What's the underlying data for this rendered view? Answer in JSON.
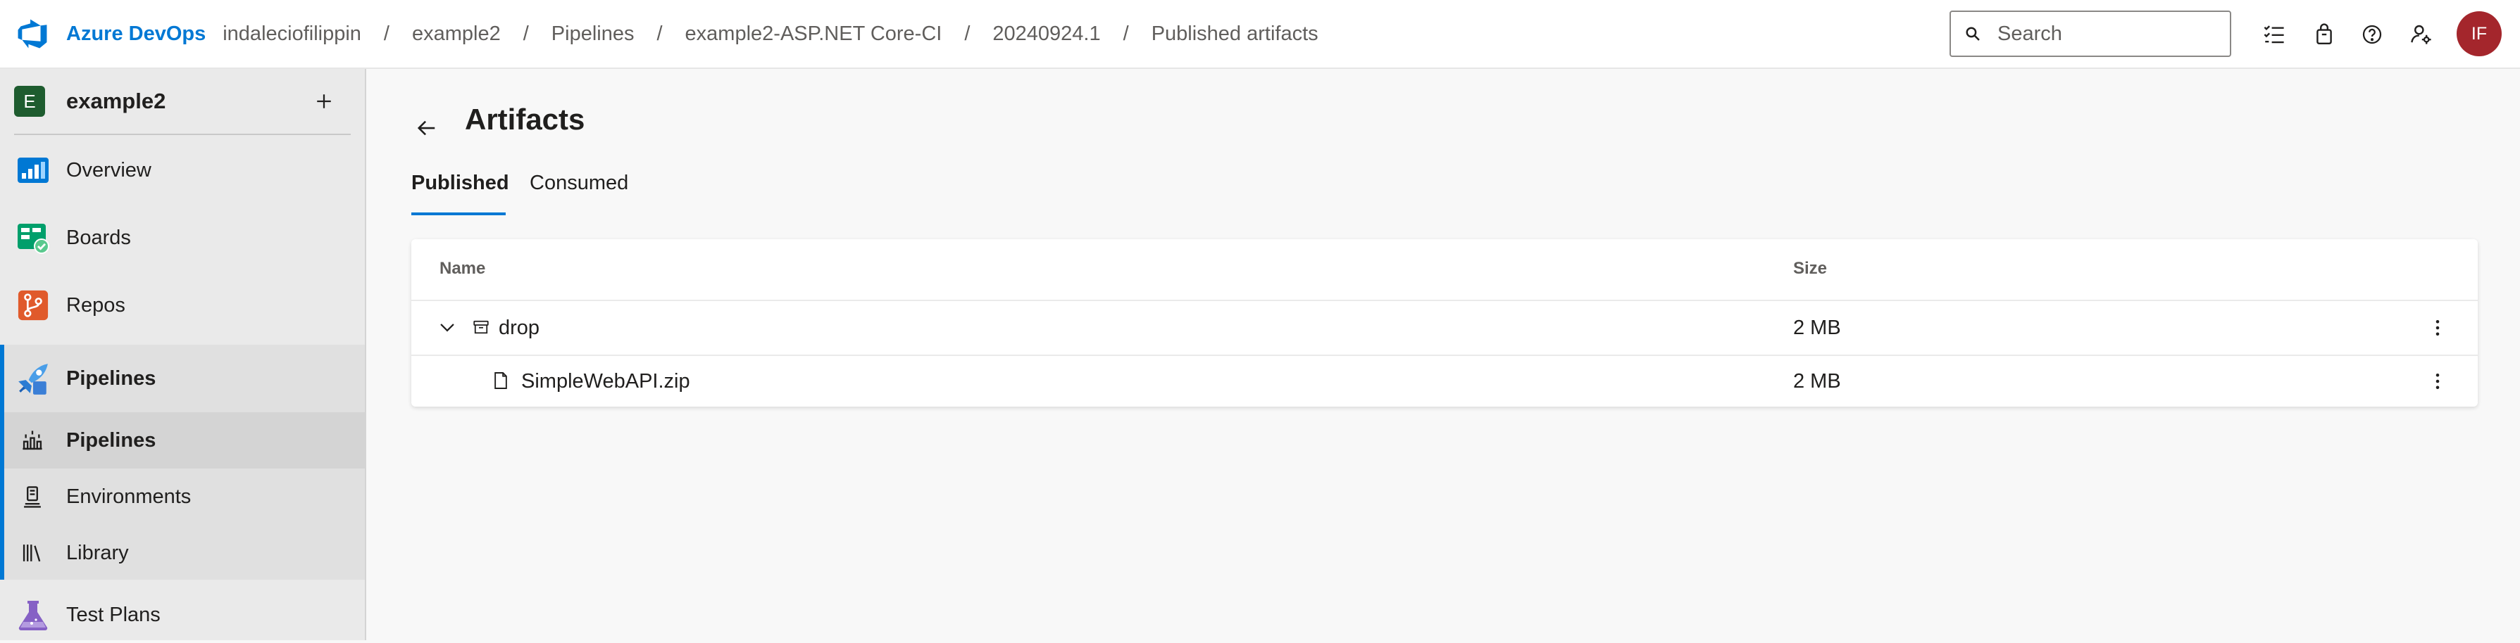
{
  "header": {
    "brand": "Azure DevOps",
    "breadcrumbs": [
      {
        "label": "indaleciofilippin"
      },
      {
        "label": "example2"
      },
      {
        "label": "Pipelines"
      },
      {
        "label": "example2-ASP.NET Core-CI"
      },
      {
        "label": "20240924.1"
      },
      {
        "label": "Published artifacts"
      }
    ],
    "separator": "/",
    "search": {
      "placeholder": "Search",
      "value": ""
    },
    "avatar_initials": "IF",
    "icons": [
      "task-list-icon",
      "shopping-bag-icon",
      "help-icon",
      "user-settings-icon"
    ]
  },
  "sidebar": {
    "project": {
      "initial": "E",
      "name": "example2"
    },
    "items": [
      {
        "label": "Overview",
        "icon": "overview-icon"
      },
      {
        "label": "Boards",
        "icon": "boards-icon"
      },
      {
        "label": "Repos",
        "icon": "repos-icon"
      },
      {
        "label": "Pipelines",
        "icon": "pipelines-icon"
      },
      {
        "label": "Pipelines",
        "icon": "pipelines-sub-icon"
      },
      {
        "label": "Environments",
        "icon": "environments-icon"
      },
      {
        "label": "Library",
        "icon": "library-icon"
      },
      {
        "label": "Test Plans",
        "icon": "test-plans-icon"
      }
    ]
  },
  "main": {
    "title": "Artifacts",
    "tabs": [
      {
        "label": "Published",
        "selected": true
      },
      {
        "label": "Consumed",
        "selected": false
      }
    ],
    "table": {
      "columns": [
        "Name",
        "Size"
      ],
      "rows": [
        {
          "name": "drop",
          "size": "2 MB",
          "type": "folder",
          "expanded": true
        },
        {
          "name": "SimpleWebAPI.zip",
          "size": "2 MB",
          "type": "file"
        }
      ]
    }
  },
  "colors": {
    "accent": "#0078d4",
    "avatar": "#a4262c",
    "project_badge": "#1e5c2f"
  }
}
